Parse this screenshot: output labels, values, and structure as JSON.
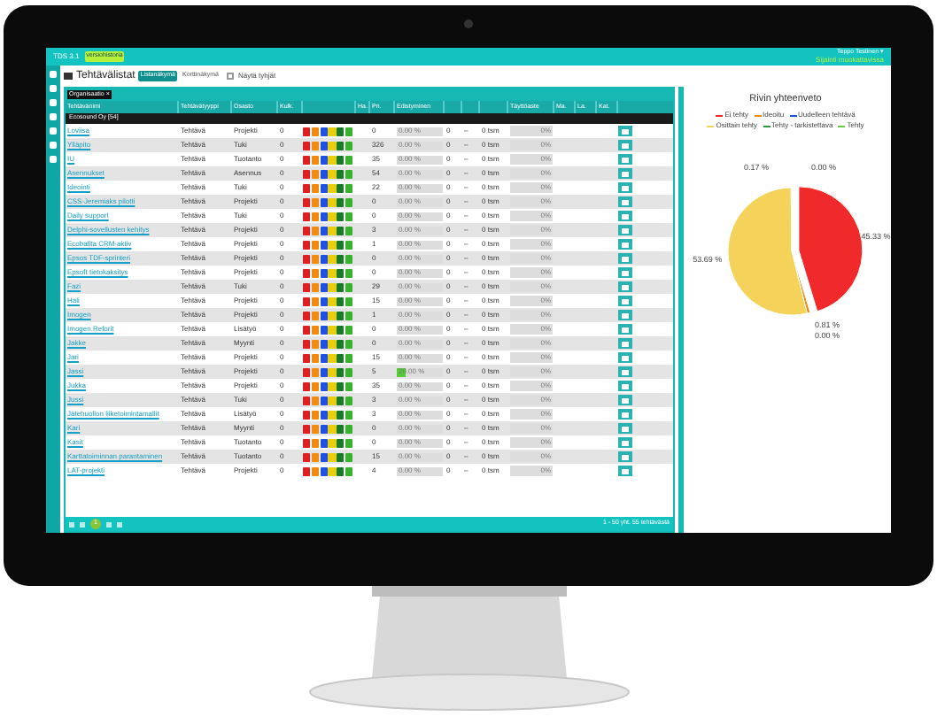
{
  "top_bar": {
    "app": "TDS 3.1",
    "badge": "versiohistoria",
    "user": "Teppo Testinen ▾",
    "user_sub": "Sijainti muokattavissa"
  },
  "title": {
    "text": "Tehtävälistat",
    "views": [
      {
        "label": "Listanäkymä",
        "selected": true
      },
      {
        "label": "Korttinäkymä",
        "selected": false
      }
    ],
    "show_empty": {
      "label": "Näytä tyhjät",
      "checked": false
    }
  },
  "group_chip": "Organisaatio ×",
  "columns": [
    "Tehtävänimi",
    "Tehtävätyyppi",
    "Osasto",
    "Kulk.",
    "",
    "Ha.",
    "Pri.",
    "Edistyminen",
    "",
    "",
    "",
    "Täyttöaste",
    "Ma.",
    "La.",
    "Kat."
  ],
  "group": "Ecosound Oy [54]",
  "badge_colors": [
    {
      "color": "#e02020"
    },
    {
      "color": "#f08a10"
    },
    {
      "color": "#2050e0"
    },
    {
      "color": "#e8d010"
    },
    {
      "color": "#1a7a2a"
    },
    {
      "color": "#38b030"
    }
  ],
  "rows": [
    {
      "name": "Loviisa",
      "type": "Tehtävä",
      "dept": "Projekti",
      "kulk": "0",
      "count": "0",
      "progress": "0.00 %",
      "level": 0,
      "c1": "0",
      "c2": "–",
      "hours": "0 tsm",
      "fill": "0%"
    },
    {
      "name": "Ylläpito",
      "type": "Tehtävä",
      "dept": "Tuki",
      "kulk": "0",
      "count": "326",
      "progress": "0.00 %",
      "level": 0,
      "c1": "0",
      "c2": "–",
      "hours": "0 tsm",
      "fill": "0%"
    },
    {
      "name": "IU",
      "type": "Tehtävä",
      "dept": "Tuotanto",
      "kulk": "0",
      "count": "35",
      "progress": "0.00 %",
      "level": 0,
      "c1": "0",
      "c2": "–",
      "hours": "0 tsm",
      "fill": "0%"
    },
    {
      "name": "Asennukset",
      "type": "Tehtävä",
      "dept": "Asennus",
      "kulk": "0",
      "count": "54",
      "progress": "0.00 %",
      "level": 0,
      "c1": "0",
      "c2": "–",
      "hours": "0 tsm",
      "fill": "0%"
    },
    {
      "name": "Ideointi",
      "type": "Tehtävä",
      "dept": "Tuki",
      "kulk": "0",
      "count": "22",
      "progress": "0.00 %",
      "level": 0,
      "c1": "0",
      "c2": "–",
      "hours": "0 tsm",
      "fill": "0%"
    },
    {
      "name": "CSS-Jeremiaks pilotti",
      "type": "Tehtävä",
      "dept": "Projekti",
      "kulk": "0",
      "count": "0",
      "progress": "0.00 %",
      "level": 0,
      "c1": "0",
      "c2": "–",
      "hours": "0 tsm",
      "fill": "0%"
    },
    {
      "name": "Daily support",
      "type": "Tehtävä",
      "dept": "Tuki",
      "kulk": "0",
      "count": "0",
      "progress": "0.00 %",
      "level": 0,
      "c1": "0",
      "c2": "–",
      "hours": "0 tsm",
      "fill": "0%"
    },
    {
      "name": "Delphi-sovellusten kehitys",
      "type": "Tehtävä",
      "dept": "Projekti",
      "kulk": "0",
      "count": "3",
      "progress": "0.00 %",
      "level": 0,
      "c1": "0",
      "c2": "–",
      "hours": "0 tsm",
      "fill": "0%"
    },
    {
      "name": "Ecoballta CRM-aktiv",
      "type": "Tehtävä",
      "dept": "Projekti",
      "kulk": "0",
      "count": "1",
      "progress": "0.00 %",
      "level": 0,
      "c1": "0",
      "c2": "–",
      "hours": "0 tsm",
      "fill": "0%"
    },
    {
      "name": "Epsos TDF-sprinteri",
      "type": "Tehtävä",
      "dept": "Projekti",
      "kulk": "0",
      "count": "0",
      "progress": "0.00 %",
      "level": 0,
      "c1": "0",
      "c2": "–",
      "hours": "0 tsm",
      "fill": "0%"
    },
    {
      "name": "Epsoft tietokaksitys",
      "type": "Tehtävä",
      "dept": "Projekti",
      "kulk": "0",
      "count": "0",
      "progress": "0.00 %",
      "level": 0,
      "c1": "0",
      "c2": "–",
      "hours": "0 tsm",
      "fill": "0%"
    },
    {
      "name": "Fazi",
      "type": "Tehtävä",
      "dept": "Tuki",
      "kulk": "0",
      "count": "29",
      "progress": "0.00 %",
      "level": 0,
      "c1": "0",
      "c2": "–",
      "hours": "0 tsm",
      "fill": "0%"
    },
    {
      "name": "Hali",
      "type": "Tehtävä",
      "dept": "Projekti",
      "kulk": "0",
      "count": "15",
      "progress": "0.00 %",
      "level": 0,
      "c1": "0",
      "c2": "–",
      "hours": "0 tsm",
      "fill": "0%"
    },
    {
      "name": "Imogen",
      "type": "Tehtävä",
      "dept": "Projekti",
      "kulk": "0",
      "count": "1",
      "progress": "0.00 %",
      "level": 0,
      "c1": "0",
      "c2": "–",
      "hours": "0 tsm",
      "fill": "0%"
    },
    {
      "name": "Imogen.Reforit",
      "type": "Tehtävä",
      "dept": "Lisätyö",
      "kulk": "0",
      "count": "0",
      "progress": "0.00 %",
      "level": 0,
      "c1": "0",
      "c2": "–",
      "hours": "0 tsm",
      "fill": "0%"
    },
    {
      "name": "Jakke",
      "type": "Tehtävä",
      "dept": "Myynti",
      "kulk": "0",
      "count": "0",
      "progress": "0.00 %",
      "level": 0,
      "c1": "0",
      "c2": "–",
      "hours": "0 tsm",
      "fill": "0%"
    },
    {
      "name": "Jari",
      "type": "Tehtävä",
      "dept": "Projekti",
      "kulk": "0",
      "count": "15",
      "progress": "0.00 %",
      "level": 0,
      "c1": "0",
      "c2": "–",
      "hours": "0 tsm",
      "fill": "0%"
    },
    {
      "name": "Jassi",
      "type": "Tehtävä",
      "dept": "Projekti",
      "kulk": "0",
      "count": "5",
      "progress": "20.00 %",
      "level": 0.2,
      "c1": "0",
      "c2": "–",
      "hours": "0 tsm",
      "fill": "0%"
    },
    {
      "name": "Jukka",
      "type": "Tehtävä",
      "dept": "Projekti",
      "kulk": "0",
      "count": "35",
      "progress": "0.00 %",
      "level": 0,
      "c1": "0",
      "c2": "–",
      "hours": "0 tsm",
      "fill": "0%"
    },
    {
      "name": "Jussi",
      "type": "Tehtävä",
      "dept": "Tuki",
      "kulk": "0",
      "count": "3",
      "progress": "0.00 %",
      "level": 0,
      "c1": "0",
      "c2": "–",
      "hours": "0 tsm",
      "fill": "0%"
    },
    {
      "name": "Jätehuollon liiketoimintamallit",
      "type": "Tehtävä",
      "dept": "Lisätyö",
      "kulk": "0",
      "count": "3",
      "progress": "0.00 %",
      "level": 0,
      "c1": "0",
      "c2": "–",
      "hours": "0 tsm",
      "fill": "0%"
    },
    {
      "name": "Kari",
      "type": "Tehtävä",
      "dept": "Myynti",
      "kulk": "0",
      "count": "0",
      "progress": "0.00 %",
      "level": 0,
      "c1": "0",
      "c2": "–",
      "hours": "0 tsm",
      "fill": "0%"
    },
    {
      "name": "Kasit",
      "type": "Tehtävä",
      "dept": "Tuotanto",
      "kulk": "0",
      "count": "0",
      "progress": "0.00 %",
      "level": 0,
      "c1": "0",
      "c2": "–",
      "hours": "0 tsm",
      "fill": "0%"
    },
    {
      "name": "Karttatoiminnan parantaminen",
      "type": "Tehtävä",
      "dept": "Tuotanto",
      "kulk": "0",
      "count": "15",
      "progress": "0.00 %",
      "level": 0,
      "c1": "0",
      "c2": "–",
      "hours": "0 tsm",
      "fill": "0%"
    },
    {
      "name": "LAT-projekti",
      "type": "Tehtävä",
      "dept": "Projekti",
      "kulk": "0",
      "count": "4",
      "progress": "0.00 %",
      "level": 0,
      "c1": "0",
      "c2": "–",
      "hours": "0 tsm",
      "fill": "0%"
    }
  ],
  "pager": {
    "pages": [
      {
        "label": "1",
        "selected": true
      }
    ],
    "summary": "1 - 50 yht. 55 tehtävästä"
  },
  "summary_panel": {
    "title": "Rivin yhteenveto",
    "chart_data": {
      "type": "pie",
      "categories": [
        "Ei tehty",
        "Ideoitu",
        "Uudelleen tehtävä",
        "Osittain tehty",
        "Tehty - tarkistettava",
        "Tehty"
      ],
      "series": [
        {
          "values": [
            45.33,
            0.81,
            0.0,
            53.69,
            0.17,
            0.0
          ]
        }
      ],
      "colors": [
        "#f02a2a",
        "#f08a10",
        "#2050e0",
        "#f5d35a",
        "#2a9a3a",
        "#60d040"
      ],
      "value_labels": [
        "45.33 %",
        "0.81 %",
        "0.00 %",
        "53.69 %",
        "0.17 %",
        "0.00 %"
      ]
    }
  }
}
